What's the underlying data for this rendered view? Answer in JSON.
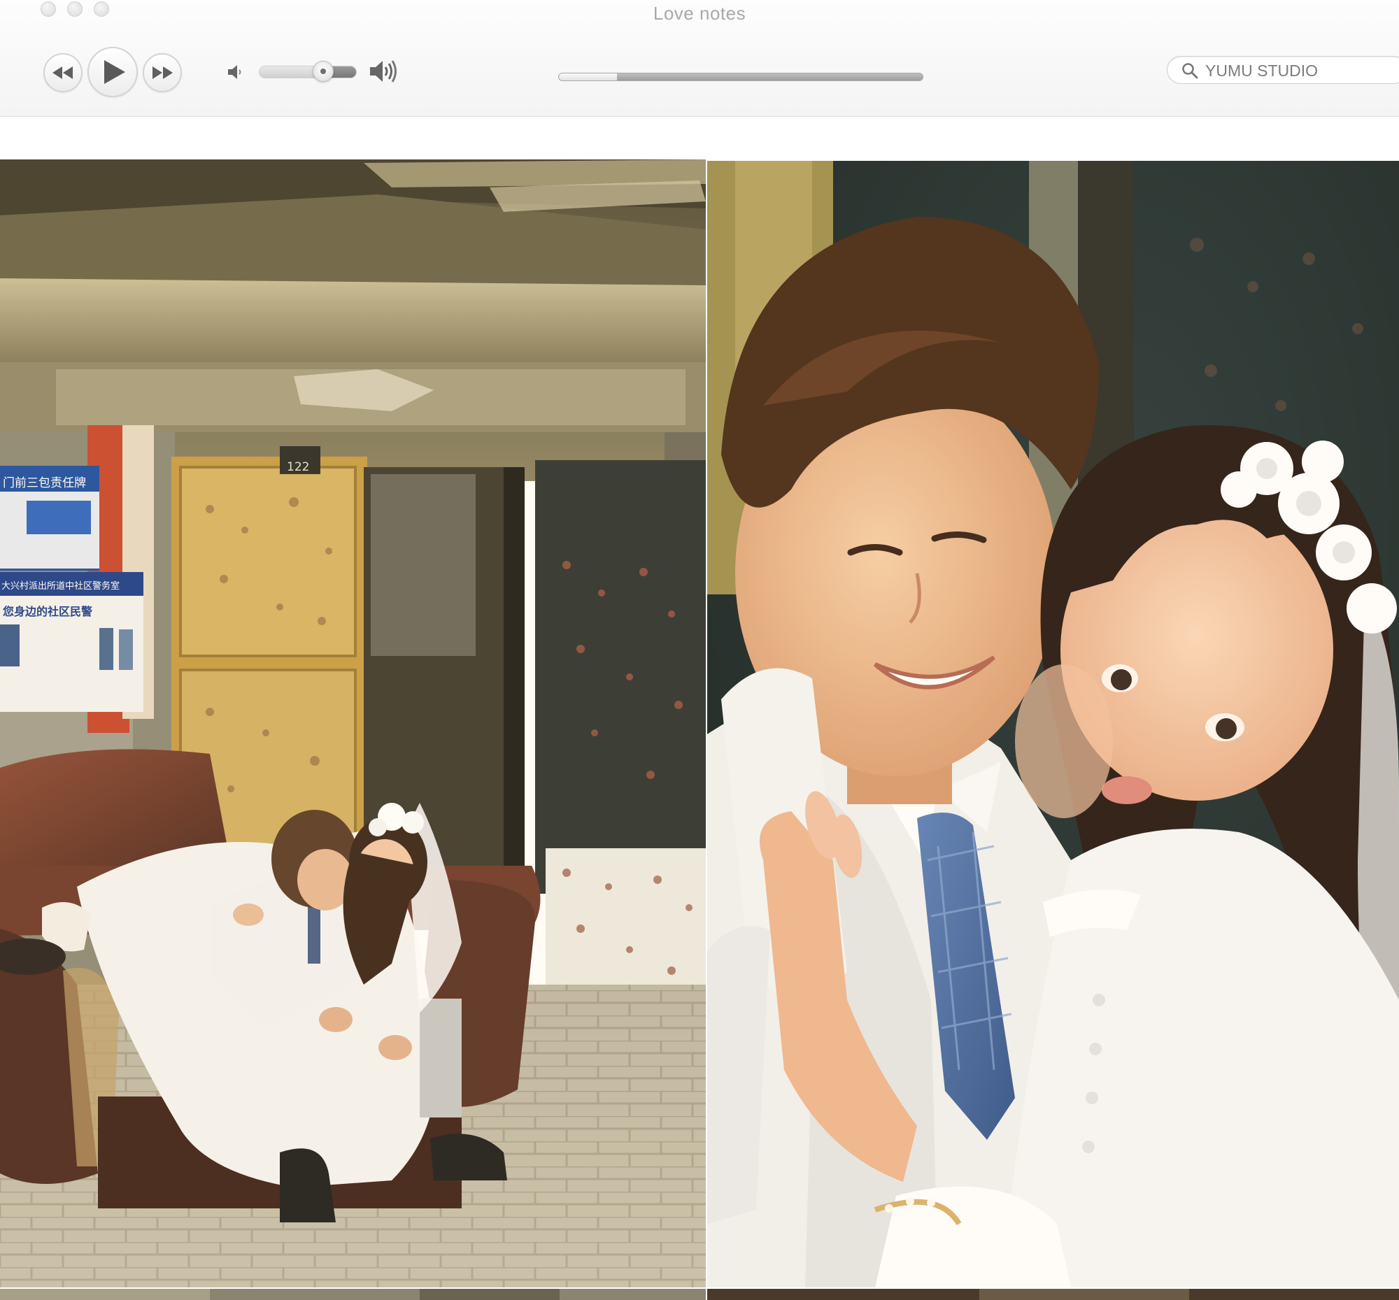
{
  "window": {
    "title": "Love notes"
  },
  "toolbar": {
    "rewind_icon": "rewind-icon",
    "play_icon": "play-icon",
    "forward_icon": "fast-forward-icon",
    "volume_low_icon": "volume-low-icon",
    "volume_high_icon": "volume-high-icon",
    "volume_level": 0.66,
    "playback_progress": 0.16
  },
  "search": {
    "value": "YUMU STUDIO",
    "icon": "search-icon"
  },
  "photos": {
    "left_signs": {
      "board_title": "门前三包责任牌",
      "station_name": "大兴村派出所道中社区警务室",
      "police_slogan": "您身边的社区民警",
      "door_number": "122"
    }
  }
}
